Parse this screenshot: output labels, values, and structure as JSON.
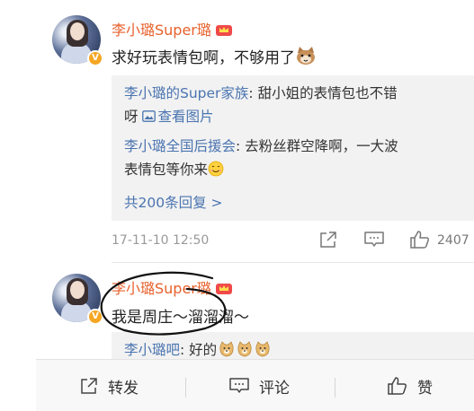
{
  "post1": {
    "username": "李小璐Super璐",
    "text": "求好玩表情包啊，不够用了",
    "replies": [
      {
        "name": "李小璐的Super家族",
        "sep": ": ",
        "text1": "甜小姐的表情包也不错",
        "text2_prefix": "呀 ",
        "link": "查看图片"
      },
      {
        "name": "李小璐全国后援会",
        "sep": ": ",
        "text1": "去粉丝群空降啊，一大波",
        "text2": "表情包等你来"
      }
    ],
    "more_replies": "共200条回复 >",
    "timestamp": "17-11-10 12:50",
    "like_count": "2407"
  },
  "post2": {
    "username": "李小璐Super璐",
    "text": "我是周庄～溜溜溜～",
    "reply": {
      "name": "李小璐吧",
      "sep": ": ",
      "text": "好的"
    }
  },
  "toolbar": {
    "repost": "转发",
    "comment": "评论",
    "like": "赞"
  },
  "colors": {
    "username": "#e8612c",
    "reply_name": "#4a74b0",
    "reply_bg": "#f2f2f2",
    "meta": "#999999"
  },
  "icons": [
    "avatar-photo",
    "verified-v-icon",
    "crown-level-icon",
    "cat-emoji-icon",
    "image-link-icon",
    "smile-emoji-icon",
    "doge-emoji-icon",
    "share-icon",
    "comment-icon",
    "thumbs-up-icon"
  ]
}
